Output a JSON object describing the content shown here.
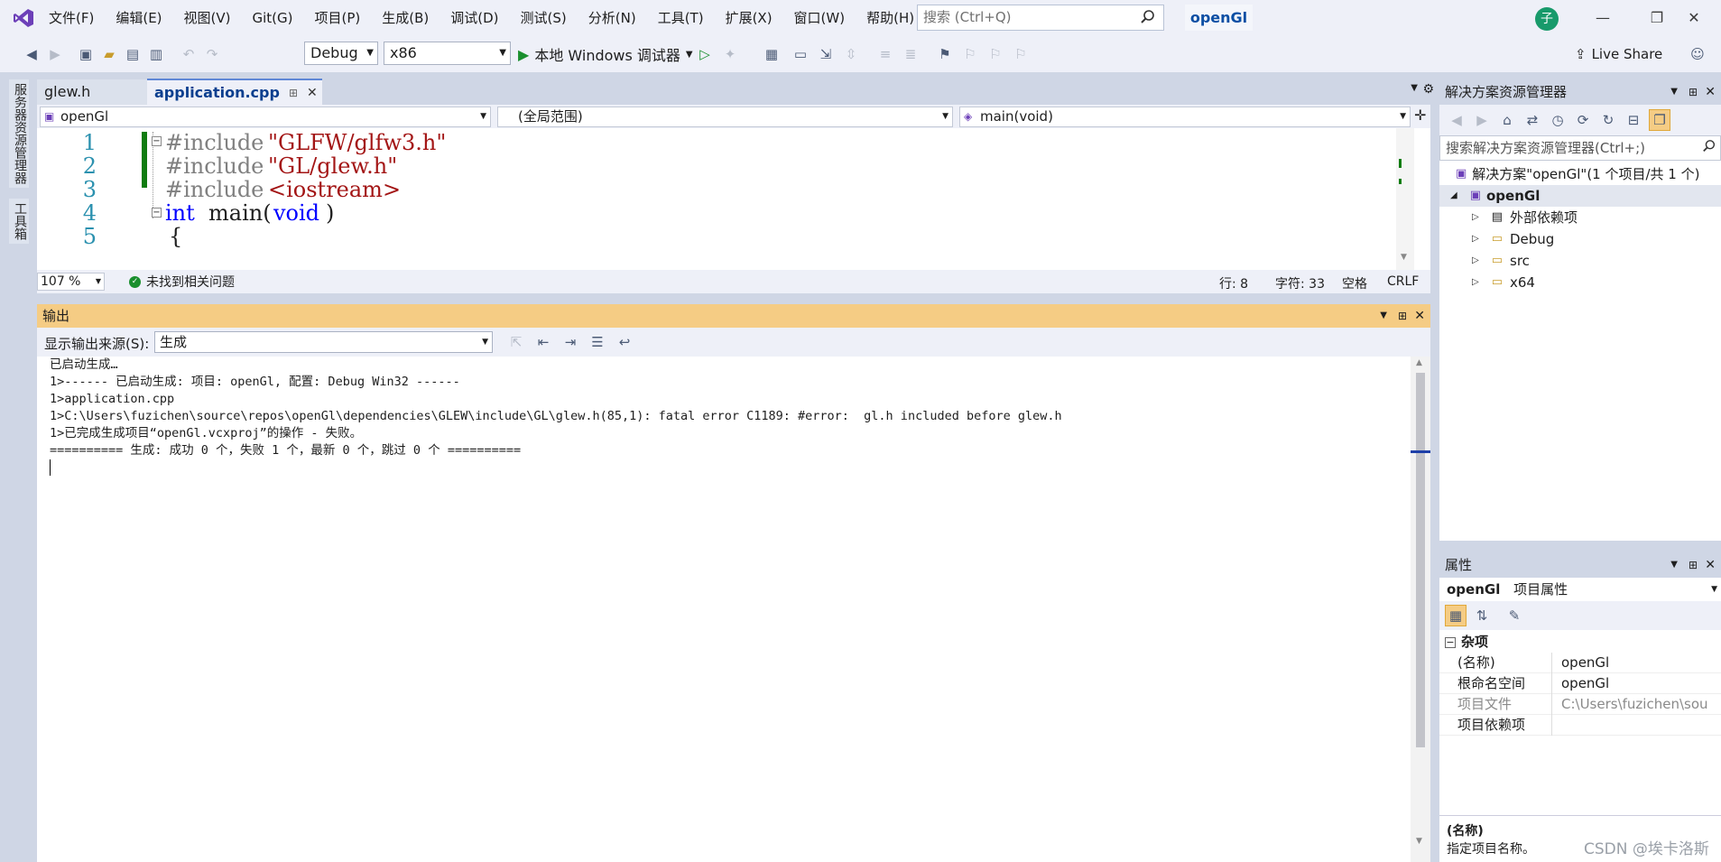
{
  "menu": {
    "items": [
      "文件(F)",
      "编辑(E)",
      "视图(V)",
      "Git(G)",
      "项目(P)",
      "生成(B)",
      "调试(D)",
      "测试(S)",
      "分析(N)",
      "工具(T)",
      "扩展(X)",
      "窗口(W)",
      "帮助(H)"
    ],
    "search_placeholder": "搜索 (Ctrl+Q)",
    "solution_name": "openGl",
    "avatar_initial": "子"
  },
  "toolbar": {
    "config": "Debug",
    "platform": "x86",
    "run_label": "本地 Windows 调试器",
    "live_share": "Live Share"
  },
  "left_strip": {
    "server_explorer": "服务器资源管理器",
    "toolbox": "工具箱"
  },
  "editor": {
    "tabs": [
      {
        "label": "glew.h",
        "active": false
      },
      {
        "label": "application.cpp",
        "active": true
      }
    ],
    "nav_project": "openGl",
    "nav_scope": "(全局范围)",
    "nav_member": "main(void)",
    "line_numbers": [
      "1",
      "2",
      "3",
      "4",
      "5"
    ],
    "code": [
      {
        "pre": "#include",
        "str": "\"GLFW/glfw3.h\""
      },
      {
        "pre": "#include",
        "str": "\"GL/glew.h\""
      },
      {
        "pre": "#include",
        "str": "<iostream>"
      },
      {
        "kw": "int",
        "plain": "main(",
        "kw2": "void",
        "plain2": ")"
      },
      {
        "plain": "{"
      }
    ],
    "zoom": "107 %",
    "issues": "未找到相关问题",
    "line": "行: 8",
    "col": "字符: 33",
    "spacing": "空格",
    "eol": "CRLF"
  },
  "output": {
    "title": "输出",
    "source_label": "显示输出来源(S):",
    "source_value": "生成",
    "lines": [
      "已启动生成…",
      "1>------ 已启动生成: 项目: openGl, 配置: Debug Win32 ------",
      "1>application.cpp",
      "1>C:\\Users\\fuzichen\\source\\repos\\openGl\\dependencies\\GLEW\\include\\GL\\glew.h(85,1): fatal error C1189: #error:  gl.h included before glew.h",
      "1>已完成生成项目“openGl.vcxproj”的操作 - 失败。",
      "========== 生成: 成功 0 个，失败 1 个，最新 0 个，跳过 0 个 =========="
    ]
  },
  "solution_explorer": {
    "title": "解决方案资源管理器",
    "search_placeholder": "搜索解决方案资源管理器(Ctrl+;)",
    "solution_row": "解决方案\"openGl\"(1 个项目/共 1 个)",
    "project": "openGl",
    "children": [
      "外部依赖项",
      "Debug",
      "src",
      "x64"
    ]
  },
  "properties": {
    "title": "属性",
    "object": "openGl",
    "object_type": "项目属性",
    "category": "杂项",
    "rows": [
      {
        "name": "(名称)",
        "value": "openGl"
      },
      {
        "name": "根命名空间",
        "value": "openGl"
      },
      {
        "name": "项目文件",
        "value": "C:\\Users\\fuzichen\\sou"
      },
      {
        "name": "项目依赖项",
        "value": ""
      }
    ],
    "desc_title": "(名称)",
    "desc_text": "指定项目名称。"
  },
  "watermark": "CSDN @埃卡洛斯"
}
